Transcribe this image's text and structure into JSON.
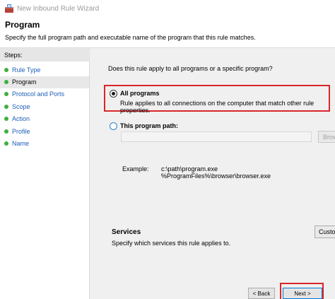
{
  "window": {
    "title": "New Inbound Rule Wizard",
    "icon": "firewall-wizard-icon"
  },
  "header": {
    "title": "Program",
    "description": "Specify the full program path and executable name of the program that this rule matches."
  },
  "steps": {
    "label": "Steps:",
    "items": [
      {
        "label": "Rule Type"
      },
      {
        "label": "Program"
      },
      {
        "label": "Protocol and Ports"
      },
      {
        "label": "Scope"
      },
      {
        "label": "Action"
      },
      {
        "label": "Profile"
      },
      {
        "label": "Name"
      }
    ],
    "active_index": 1,
    "dot_color": "#3fae3f",
    "link_color": "#1c5fb8"
  },
  "content": {
    "question": "Does this rule apply to all programs or a specific program?",
    "all_programs": {
      "label": "All programs",
      "description": "Rule applies to all connections on the computer that match other rule properties.",
      "checked": true
    },
    "this_program": {
      "label": "This program path:",
      "value": "",
      "checked": false
    },
    "browse_label": "Browse...",
    "example_label": "Example:",
    "example_lines": [
      "c:\\path\\program.exe",
      "%ProgramFiles%\\browser\\browser.exe"
    ],
    "services": {
      "title": "Services",
      "description": "Specify which services this rule applies to.",
      "button_label": "Customize..."
    }
  },
  "footer": {
    "back_label": "< Back",
    "next_label": "Next >"
  },
  "highlight_color": "#d9262a"
}
